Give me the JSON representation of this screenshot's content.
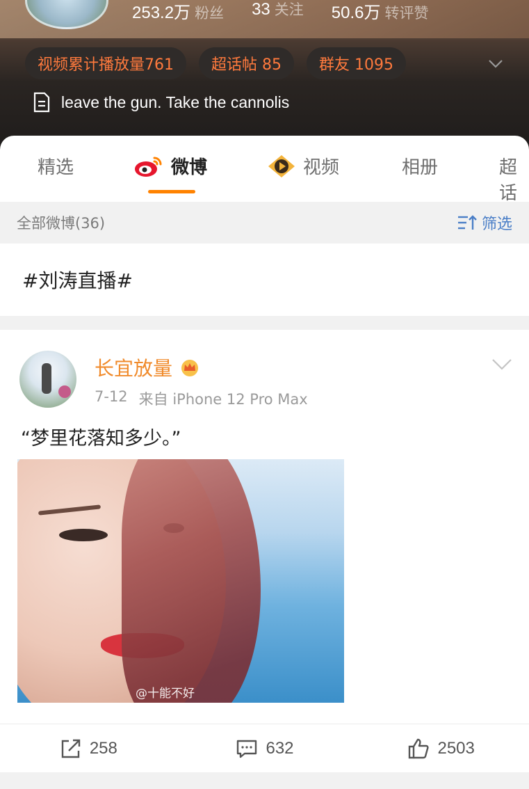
{
  "profile": {
    "stats": [
      {
        "value": "253.2万",
        "label": "粉丝"
      },
      {
        "value": "33",
        "label": "关注"
      },
      {
        "value": "50.6万",
        "label": "转评赞"
      }
    ],
    "chips": [
      "视频累计播放量761",
      "超话帖 85",
      "群友 1095"
    ],
    "bio": "leave the gun. Take the cannolis"
  },
  "tabs": [
    {
      "label": "精选",
      "icon": null
    },
    {
      "label": "微博",
      "icon": "weibo-icon"
    },
    {
      "label": "视频",
      "icon": "video-play-icon"
    },
    {
      "label": "相册",
      "icon": null
    },
    {
      "label": "超话",
      "icon": null
    }
  ],
  "filter_bar": {
    "all_label": "全部微博(36)",
    "filter_label": "筛选"
  },
  "topic": "#刘涛直播#",
  "post": {
    "author": "长宜放量",
    "date": "7-12",
    "source": "来自 iPhone 12 Pro Max",
    "text": "“梦里花落知多少。”",
    "watermark": "@十能不好",
    "actions": {
      "repost": "258",
      "comment": "632",
      "like": "2503"
    }
  },
  "colors": {
    "accent": "#ff8200",
    "author": "#f08a2a",
    "chip_text": "#ff7a3d",
    "link_blue": "#4a7ec7"
  }
}
